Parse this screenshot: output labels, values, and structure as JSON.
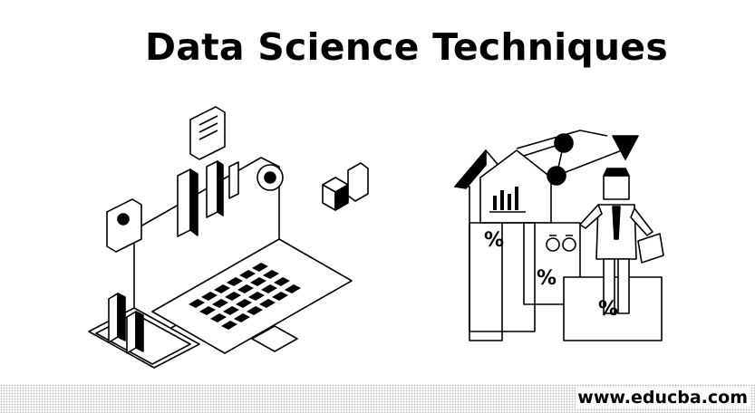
{
  "header": {
    "title": "Data Science Techniques"
  },
  "illustrations": {
    "left": {
      "percent_glyphs": []
    },
    "right": {
      "percent_glyph": "%"
    }
  },
  "footer": {
    "url": "www.educba.com"
  }
}
